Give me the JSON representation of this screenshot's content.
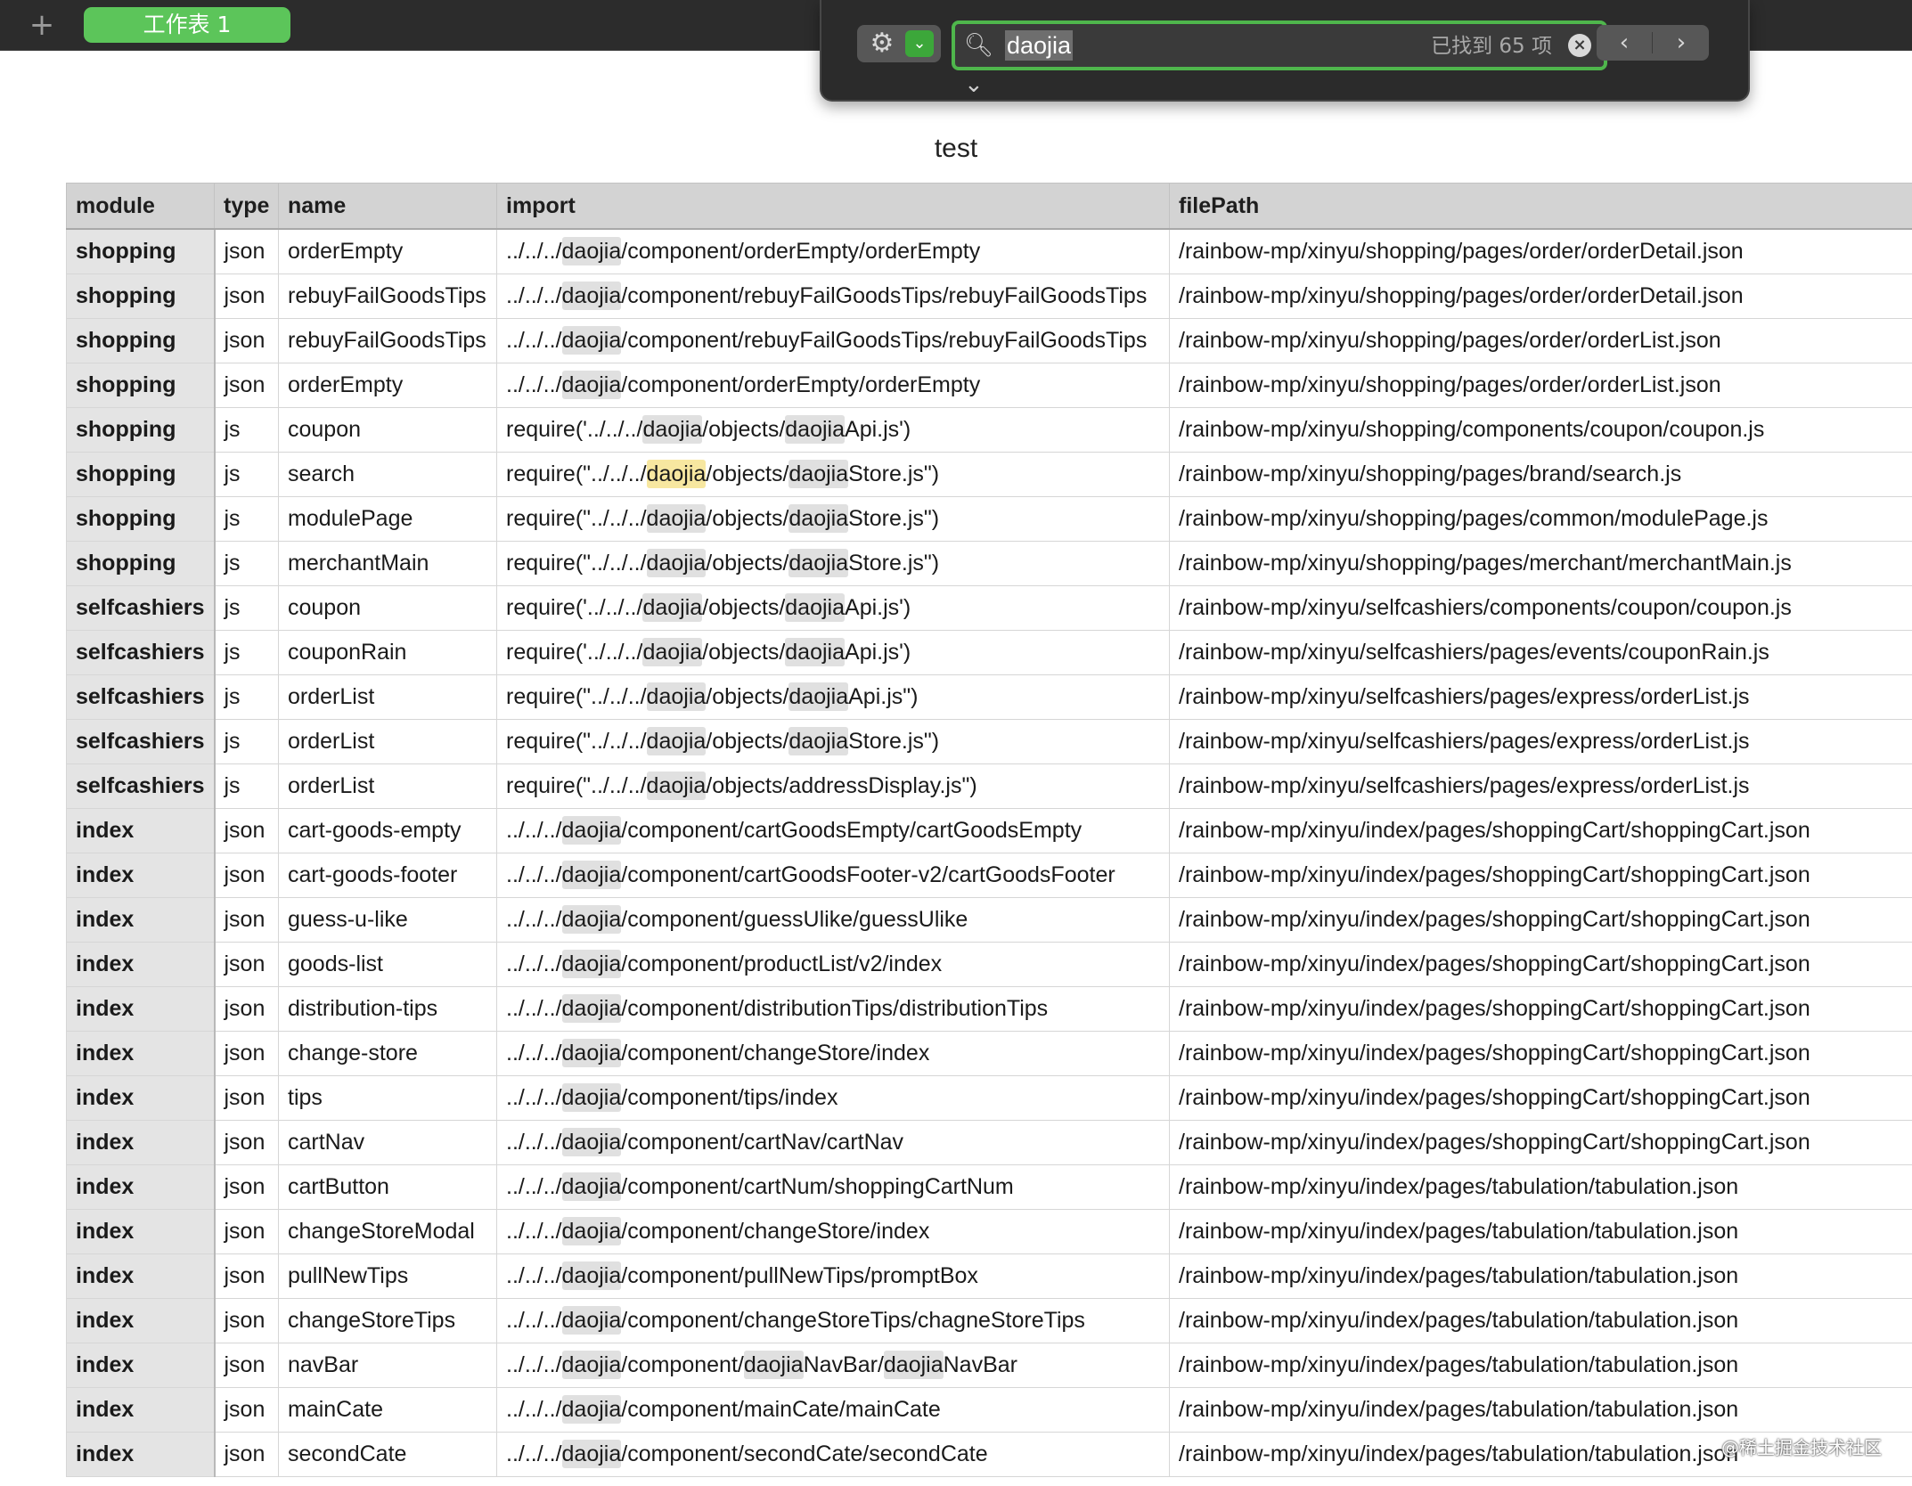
{
  "toolbar": {
    "add_sheet_symbol": "+",
    "sheet_tab_label": "工作表 1"
  },
  "find": {
    "gear_symbol": "⚙",
    "chevron_symbol": "⌄",
    "magnifier_symbol": "🔍︎⌄",
    "query": "daojia",
    "result_count": "已找到 65 项",
    "clear_symbol": "×",
    "prev_symbol": "‹",
    "next_symbol": "›",
    "accent_color": "#4fb64c"
  },
  "sheet": {
    "title": "test",
    "headers": [
      "module",
      "type",
      "name",
      "import",
      "filePath"
    ],
    "highlight_term": "daojia",
    "current_match": {
      "row": 5,
      "occurrence": 0
    },
    "rows": [
      [
        "shopping",
        "json",
        "orderEmpty",
        "../../../daojia/component/orderEmpty/orderEmpty",
        "/rainbow-mp/xinyu/shopping/pages/order/orderDetail.json"
      ],
      [
        "shopping",
        "json",
        "rebuyFailGoodsTips",
        "../../../daojia/component/rebuyFailGoodsTips/rebuyFailGoodsTips",
        "/rainbow-mp/xinyu/shopping/pages/order/orderDetail.json"
      ],
      [
        "shopping",
        "json",
        "rebuyFailGoodsTips",
        "../../../daojia/component/rebuyFailGoodsTips/rebuyFailGoodsTips",
        "/rainbow-mp/xinyu/shopping/pages/order/orderList.json"
      ],
      [
        "shopping",
        "json",
        "orderEmpty",
        "../../../daojia/component/orderEmpty/orderEmpty",
        "/rainbow-mp/xinyu/shopping/pages/order/orderList.json"
      ],
      [
        "shopping",
        "js",
        "coupon",
        "require('../../../daojia/objects/daojiaApi.js')",
        "/rainbow-mp/xinyu/shopping/components/coupon/coupon.js"
      ],
      [
        "shopping",
        "js",
        "search",
        "require(\"../../../daojia/objects/daojiaStore.js\")",
        "/rainbow-mp/xinyu/shopping/pages/brand/search.js"
      ],
      [
        "shopping",
        "js",
        "modulePage",
        "require(\"../../../daojia/objects/daojiaStore.js\")",
        "/rainbow-mp/xinyu/shopping/pages/common/modulePage.js"
      ],
      [
        "shopping",
        "js",
        "merchantMain",
        "require(\"../../../daojia/objects/daojiaStore.js\")",
        "/rainbow-mp/xinyu/shopping/pages/merchant/merchantMain.js"
      ],
      [
        "selfcashiers",
        "js",
        "coupon",
        "require('../../../daojia/objects/daojiaApi.js')",
        "/rainbow-mp/xinyu/selfcashiers/components/coupon/coupon.js"
      ],
      [
        "selfcashiers",
        "js",
        "couponRain",
        "require('../../../daojia/objects/daojiaApi.js')",
        "/rainbow-mp/xinyu/selfcashiers/pages/events/couponRain.js"
      ],
      [
        "selfcashiers",
        "js",
        "orderList",
        "require(\"../../../daojia/objects/daojiaApi.js\")",
        "/rainbow-mp/xinyu/selfcashiers/pages/express/orderList.js"
      ],
      [
        "selfcashiers",
        "js",
        "orderList",
        "require(\"../../../daojia/objects/daojiaStore.js\")",
        "/rainbow-mp/xinyu/selfcashiers/pages/express/orderList.js"
      ],
      [
        "selfcashiers",
        "js",
        "orderList",
        "require(\"../../../daojia/objects/addressDisplay.js\")",
        "/rainbow-mp/xinyu/selfcashiers/pages/express/orderList.js"
      ],
      [
        "index",
        "json",
        "cart-goods-empty",
        "../../../daojia/component/cartGoodsEmpty/cartGoodsEmpty",
        "/rainbow-mp/xinyu/index/pages/shoppingCart/shoppingCart.json"
      ],
      [
        "index",
        "json",
        "cart-goods-footer",
        "../../../daojia/component/cartGoodsFooter-v2/cartGoodsFooter",
        "/rainbow-mp/xinyu/index/pages/shoppingCart/shoppingCart.json"
      ],
      [
        "index",
        "json",
        "guess-u-like",
        "../../../daojia/component/guessUlike/guessUlike",
        "/rainbow-mp/xinyu/index/pages/shoppingCart/shoppingCart.json"
      ],
      [
        "index",
        "json",
        "goods-list",
        "../../../daojia/component/productList/v2/index",
        "/rainbow-mp/xinyu/index/pages/shoppingCart/shoppingCart.json"
      ],
      [
        "index",
        "json",
        "distribution-tips",
        "../../../daojia/component/distributionTips/distributionTips",
        "/rainbow-mp/xinyu/index/pages/shoppingCart/shoppingCart.json"
      ],
      [
        "index",
        "json",
        "change-store",
        "../../../daojia/component/changeStore/index",
        "/rainbow-mp/xinyu/index/pages/shoppingCart/shoppingCart.json"
      ],
      [
        "index",
        "json",
        "tips",
        "../../../daojia/component/tips/index",
        "/rainbow-mp/xinyu/index/pages/shoppingCart/shoppingCart.json"
      ],
      [
        "index",
        "json",
        "cartNav",
        "../../../daojia/component/cartNav/cartNav",
        "/rainbow-mp/xinyu/index/pages/shoppingCart/shoppingCart.json"
      ],
      [
        "index",
        "json",
        "cartButton",
        "../../../daojia/component/cartNum/shoppingCartNum",
        "/rainbow-mp/xinyu/index/pages/tabulation/tabulation.json"
      ],
      [
        "index",
        "json",
        "changeStoreModal",
        "../../../daojia/component/changeStore/index",
        "/rainbow-mp/xinyu/index/pages/tabulation/tabulation.json"
      ],
      [
        "index",
        "json",
        "pullNewTips",
        "../../../daojia/component/pullNewTips/promptBox",
        "/rainbow-mp/xinyu/index/pages/tabulation/tabulation.json"
      ],
      [
        "index",
        "json",
        "changeStoreTips",
        "../../../daojia/component/changeStoreTips/chagneStoreTips",
        "/rainbow-mp/xinyu/index/pages/tabulation/tabulation.json"
      ],
      [
        "index",
        "json",
        "navBar",
        "../../../daojia/component/daojiaNavBar/daojiaNavBar",
        "/rainbow-mp/xinyu/index/pages/tabulation/tabulation.json"
      ],
      [
        "index",
        "json",
        "mainCate",
        "../../../daojia/component/mainCate/mainCate",
        "/rainbow-mp/xinyu/index/pages/tabulation/tabulation.json"
      ],
      [
        "index",
        "json",
        "secondCate",
        "../../../daojia/component/secondCate/secondCate",
        "/rainbow-mp/xinyu/index/pages/tabulation/tabulation.json"
      ]
    ]
  },
  "watermark": "@稀土掘金技术社区"
}
